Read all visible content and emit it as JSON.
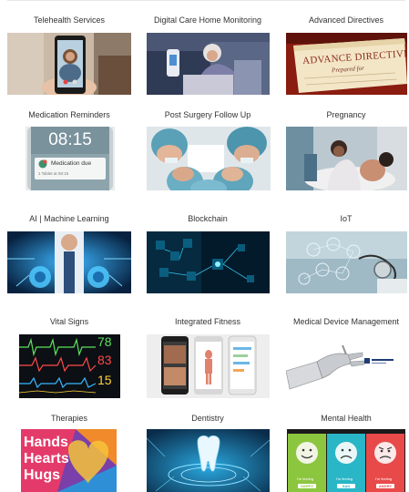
{
  "tiles": [
    {
      "label": "Telehealth Services",
      "icon": "telehealth-phone-icon"
    },
    {
      "label": "Digital Care Home Monitoring",
      "icon": "elderly-monitoring-icon"
    },
    {
      "label": "Advanced Directives",
      "icon": "document-icon",
      "image_text": "ADVANCE DIRECTIVE",
      "image_subtext": "Prepared for"
    },
    {
      "label": "Medication Reminders",
      "icon": "phone-alarm-icon",
      "image_time": "08:15",
      "image_title": "Medication due",
      "image_sub": "1 Tablet at 08:15"
    },
    {
      "label": "Post Surgery Follow Up",
      "icon": "surgeons-icon"
    },
    {
      "label": "Pregnancy",
      "icon": "pregnancy-icon"
    },
    {
      "label": "AI | Machine Learning",
      "icon": "ai-brain-icon"
    },
    {
      "label": "Blockchain",
      "icon": "blockchain-icon"
    },
    {
      "label": "IoT",
      "icon": "iot-stethoscope-icon"
    },
    {
      "label": "Vital Signs",
      "icon": "vital-monitor-icon",
      "image_numbers": [
        "78",
        "83",
        "15"
      ]
    },
    {
      "label": "Integrated Fitness",
      "icon": "fitness-phones-icon"
    },
    {
      "label": "Medical Device Management",
      "icon": "robot-hand-icon"
    },
    {
      "label": "Therapies",
      "icon": "hands-hearts-hugs-icon",
      "image_lines": [
        "Hands",
        "Hearts",
        "Hugs"
      ]
    },
    {
      "label": "Dentistry",
      "icon": "tooth-icon"
    },
    {
      "label": "Mental Health",
      "icon": "mood-faces-icon",
      "image_captions": [
        "I'm feeling",
        "I'm feeling",
        "I'm feeling"
      ],
      "image_badges": [
        "HAPPY",
        "SAD",
        "ANGRY"
      ]
    }
  ],
  "colors": {
    "text": "#333333",
    "background": "#ffffff"
  }
}
